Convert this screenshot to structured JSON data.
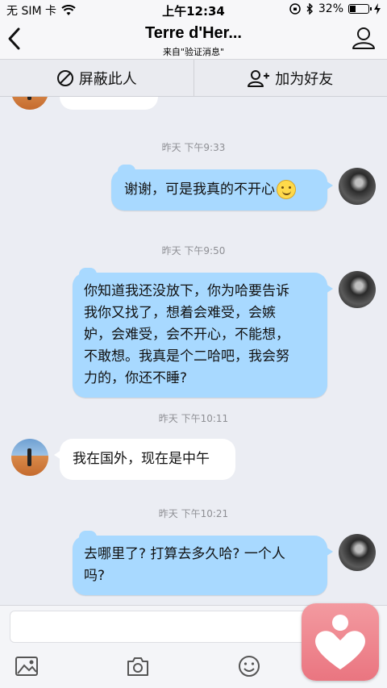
{
  "status_bar": {
    "carrier": "无 SIM 卡",
    "time": "上午12:34",
    "battery": "32%",
    "battery_level": 0.32
  },
  "header": {
    "title": "Terre d'Her...",
    "subtitle": "来自\"验证消息\""
  },
  "actions": {
    "block_label": "屏蔽此人",
    "add_friend_label": "加为好友"
  },
  "messages": [
    {
      "time": "昨天  下午9:33",
      "direction": "outgoing",
      "text": "谢谢，可是我真的不开心",
      "emoji": "smiley-icon"
    },
    {
      "time": "昨天  下午9:50",
      "direction": "outgoing",
      "text": "你知道我还没放下，你为哈要告诉\n我你又找了，想着会难受，会嫉\n妒，会难受，会不开心，不能想，\n不敢想。我真是个二哈吧，我会努\n力的，你还不睡?"
    },
    {
      "time": "昨天  下午10:11",
      "direction": "incoming",
      "text": "我在国外，现在是中午"
    },
    {
      "time": "昨天  下午10:21",
      "direction": "outgoing",
      "text": "去哪里了? 打算去多久哈? 一个人\n吗?"
    }
  ],
  "colors": {
    "outgoing_bubble": "#a8d9ff",
    "incoming_bubble": "#ffffff",
    "background": "#ebedf3",
    "app_overlay": "#ea7580"
  }
}
